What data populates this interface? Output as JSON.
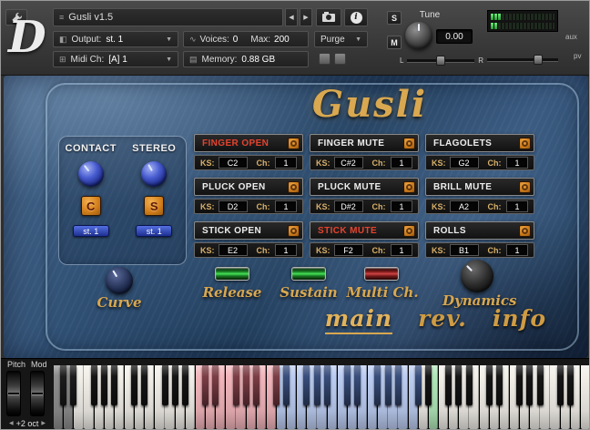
{
  "header": {
    "instrument_name": "Gusli v1.5",
    "logo": "D",
    "output_label": "Output:",
    "output_value": "st. 1",
    "midi_label": "Midi Ch:",
    "midi_value": "[A] 1",
    "voices_label": "Voices:",
    "voices_value": "0",
    "max_label": "Max:",
    "max_value": "200",
    "memory_label": "Memory:",
    "memory_value": "0.88 GB",
    "purge_label": "Purge",
    "solo_label": "S",
    "mute_label": "M",
    "tune_label": "Tune",
    "tune_value": "0.00",
    "aux_label": "aux",
    "pv_label": "pv",
    "pan_left": "L",
    "pan_right": "R"
  },
  "icons": {
    "menu": "≡",
    "prev": "◀",
    "next": "▶",
    "dropdown": "▼",
    "output": "◧",
    "midi": "⊞",
    "voices": "∿",
    "memory": "▤",
    "info": "i",
    "oct_left": "◀",
    "oct_right": "▶"
  },
  "instrument": {
    "title": "Gusli",
    "left_panel": {
      "contact_label": "CONTACT",
      "stereo_label": "STEREO",
      "contact_button": "C",
      "stereo_button": "S",
      "contact_output": "st. 1",
      "stereo_output": "st. 1",
      "curve_label": "Curve"
    },
    "ks_label": "KS:",
    "ch_label": "Ch:",
    "articulations": [
      {
        "name": "FINGER OPEN",
        "active": true,
        "ks": "C2",
        "ch": "1"
      },
      {
        "name": "FINGER MUTE",
        "active": false,
        "ks": "C#2",
        "ch": "1"
      },
      {
        "name": "FLAGOLETS",
        "active": false,
        "ks": "G2",
        "ch": "1"
      },
      {
        "name": "PLUCK OPEN",
        "active": false,
        "ks": "D2",
        "ch": "1"
      },
      {
        "name": "PLUCK MUTE",
        "active": false,
        "ks": "D#2",
        "ch": "1"
      },
      {
        "name": "BRILL MUTE",
        "active": false,
        "ks": "A2",
        "ch": "1"
      },
      {
        "name": "STICK OPEN",
        "active": false,
        "ks": "E2",
        "ch": "1"
      },
      {
        "name": "STICK MUTE",
        "active": true,
        "ks": "F2",
        "ch": "1"
      },
      {
        "name": "ROLLS",
        "active": false,
        "ks": "B1",
        "ch": "1"
      }
    ],
    "buttons": [
      {
        "label": "Release",
        "color": "green"
      },
      {
        "label": "Sustain",
        "color": "green"
      },
      {
        "label": "Multi Ch.",
        "color": "red"
      }
    ],
    "dynamics_label": "Dynamics",
    "tabs": [
      {
        "label": "main",
        "active": true
      },
      {
        "label": "rev.",
        "active": false
      },
      {
        "label": "info",
        "active": false
      }
    ]
  },
  "keyboard": {
    "pitch_label": "Pitch",
    "mod_label": "Mod",
    "octave_label": "+2 oct",
    "total_white_keys": 53,
    "segments": [
      {
        "from": 0,
        "to": 1,
        "white": "#8d8d8d",
        "black": "#1c1c1c"
      },
      {
        "from": 2,
        "to": 13,
        "white": "#f2efe9",
        "black": "#151515"
      },
      {
        "from": 14,
        "to": 21,
        "white": "#f2b6bc",
        "black": "#7c3e46"
      },
      {
        "from": 22,
        "to": 35,
        "white": "#bccdf2",
        "black": "#394e7c"
      },
      {
        "from": 36,
        "to": 36,
        "white": "#f2efe9",
        "black": "#151515"
      },
      {
        "from": 37,
        "to": 37,
        "white": "#b2e8ba",
        "black": "#3d7450"
      },
      {
        "from": 38,
        "to": 52,
        "white": "#f2efe9",
        "black": "#151515"
      }
    ]
  },
  "colors": {
    "gold_accent": "#d8a74f",
    "orange_button": "#d4801c",
    "active_articulation": "#e5432e",
    "led_green": "#45e257",
    "led_red": "#d04545",
    "panel_blue": "#2f4f73"
  }
}
